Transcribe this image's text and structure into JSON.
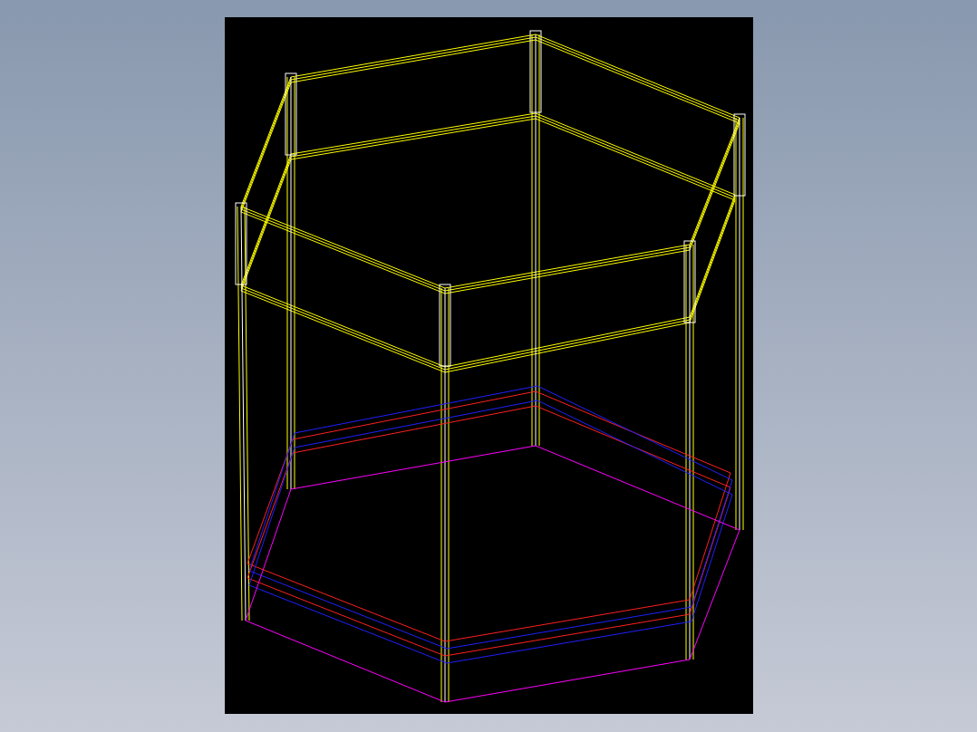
{
  "viewport": {
    "kind": "wireframe"
  }
}
